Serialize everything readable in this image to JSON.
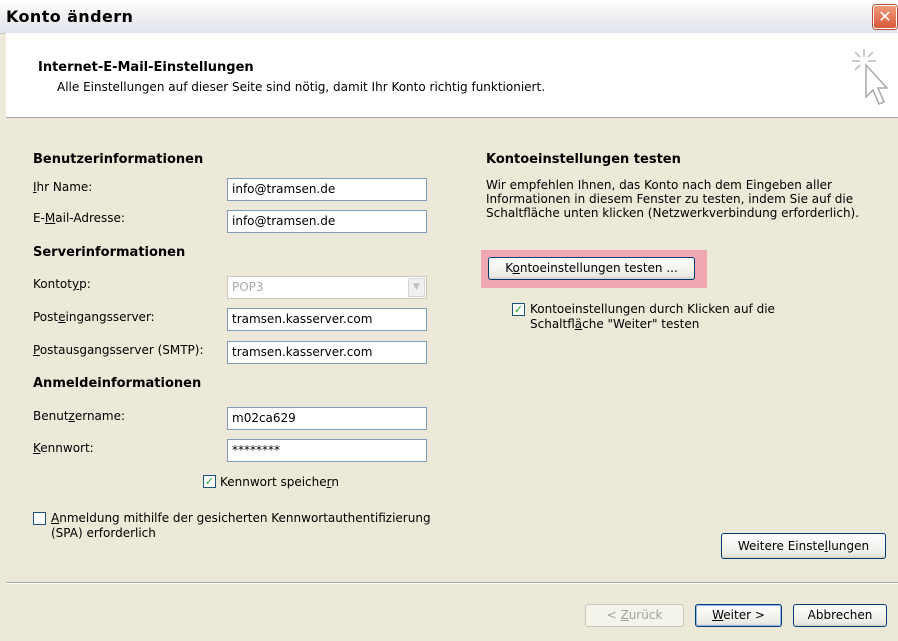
{
  "window": {
    "title": "Konto ändern"
  },
  "header": {
    "title": "Internet-E-Mail-Einstellungen",
    "subtitle": "Alle Einstellungen auf dieser Seite sind nötig, damit Ihr Konto richtig funktioniert."
  },
  "user_info": {
    "heading": "Benutzerinformationen",
    "name_label": [
      "",
      "I",
      "hr Name:"
    ],
    "name_value": "info@tramsen.de",
    "email_label": [
      "E-",
      "M",
      "ail-Adresse:"
    ],
    "email_value": "info@tramsen.de"
  },
  "server_info": {
    "heading": "Serverinformationen",
    "type_label": [
      "Kontot",
      "y",
      "p:"
    ],
    "type_value": "POP3",
    "incoming_label": [
      "Post",
      "e",
      "ingangsserver:"
    ],
    "incoming_value": "tramsen.kasserver.com",
    "outgoing_label": [
      "",
      "P",
      "ostausgangsserver (SMTP):"
    ],
    "outgoing_value": "tramsen.kasserver.com"
  },
  "login_info": {
    "heading": "Anmeldeinformationen",
    "user_label": [
      "Benut",
      "z",
      "ername:"
    ],
    "user_value": "m02ca629",
    "password_label": [
      "",
      "K",
      "ennwort:"
    ],
    "password_value": "********",
    "save_password": [
      "Kennwort speiche",
      "r",
      "n"
    ],
    "save_password_checked": true,
    "spa_line1": [
      "",
      "A",
      "nmeldung mithilfe der gesicherten Kennwortauthentifizierung"
    ],
    "spa_line2": "(SPA) erforderlich",
    "spa_checked": false
  },
  "test": {
    "heading": "Kontoeinstellungen testen",
    "description": "Wir empfehlen Ihnen, das Konto nach dem Eingeben aller Informationen in diesem Fenster zu testen, indem Sie auf die Schaltfläche unten klicken (Netzwerkverbindung erforderlich).",
    "button": [
      "K",
      "o",
      "ntoeinstellungen testen ..."
    ],
    "auto_test_line1": "Kontoeinstellungen durch Klicken auf die",
    "auto_test_line2": [
      "Schaltfl",
      "ä",
      "che \"Weiter\" testen"
    ],
    "auto_test_checked": true
  },
  "more_settings": [
    "Weitere Einste",
    "l",
    "lungen"
  ],
  "nav": {
    "back": [
      "< ",
      "Z",
      "urück"
    ],
    "next": [
      "",
      "W",
      "eiter >"
    ],
    "cancel": "Abbrechen"
  },
  "colors": {
    "highlight": "#f0a7b1",
    "accent_border": "#7f9db9",
    "check": "#21a121"
  }
}
